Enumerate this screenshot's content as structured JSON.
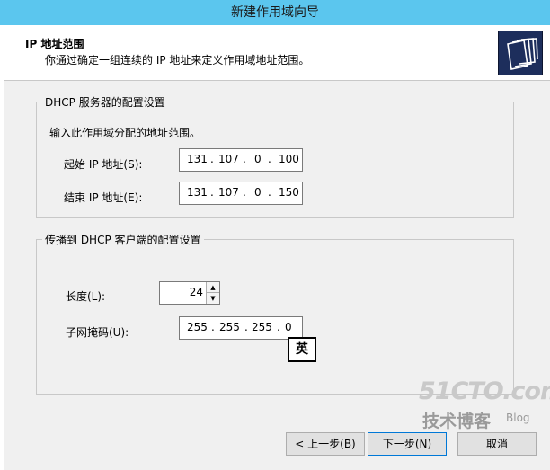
{
  "window": {
    "title": "新建作用域向导"
  },
  "header": {
    "title": "IP 地址范围",
    "description": "你通过确定一组连续的 IP 地址来定义作用域地址范围。"
  },
  "dhcp_server_group": {
    "legend": "DHCP 服务器的配置设置",
    "instruction": "输入此作用域分配的地址范围。",
    "start_label": "起始 IP 地址(S):",
    "start_ip": [
      "131",
      "107",
      "0",
      "100"
    ],
    "end_label": "结束 IP 地址(E):",
    "end_ip": [
      "131",
      "107",
      "0",
      "150"
    ]
  },
  "client_group": {
    "legend": "传播到 DHCP 客户端的配置设置",
    "length_label": "长度(L):",
    "length_value": "24",
    "mask_label": "子网掩码(U):",
    "mask": [
      "255",
      "255",
      "255",
      "0"
    ]
  },
  "ime_indicator": "英",
  "buttons": {
    "back": "< 上一步(B)",
    "next": "下一步(N)",
    "cancel": "取消"
  },
  "watermark": {
    "site": "51CTO.com",
    "tagline": "技术博客",
    "blog": "Blog"
  },
  "icons": {
    "header_icon": "folder-stack-icon",
    "spin_up": "spin-up-arrow-icon",
    "spin_down": "spin-down-arrow-icon"
  },
  "colors": {
    "titlebar": "#5bc6ee",
    "header_icon_bg": "#1d2e5c"
  }
}
